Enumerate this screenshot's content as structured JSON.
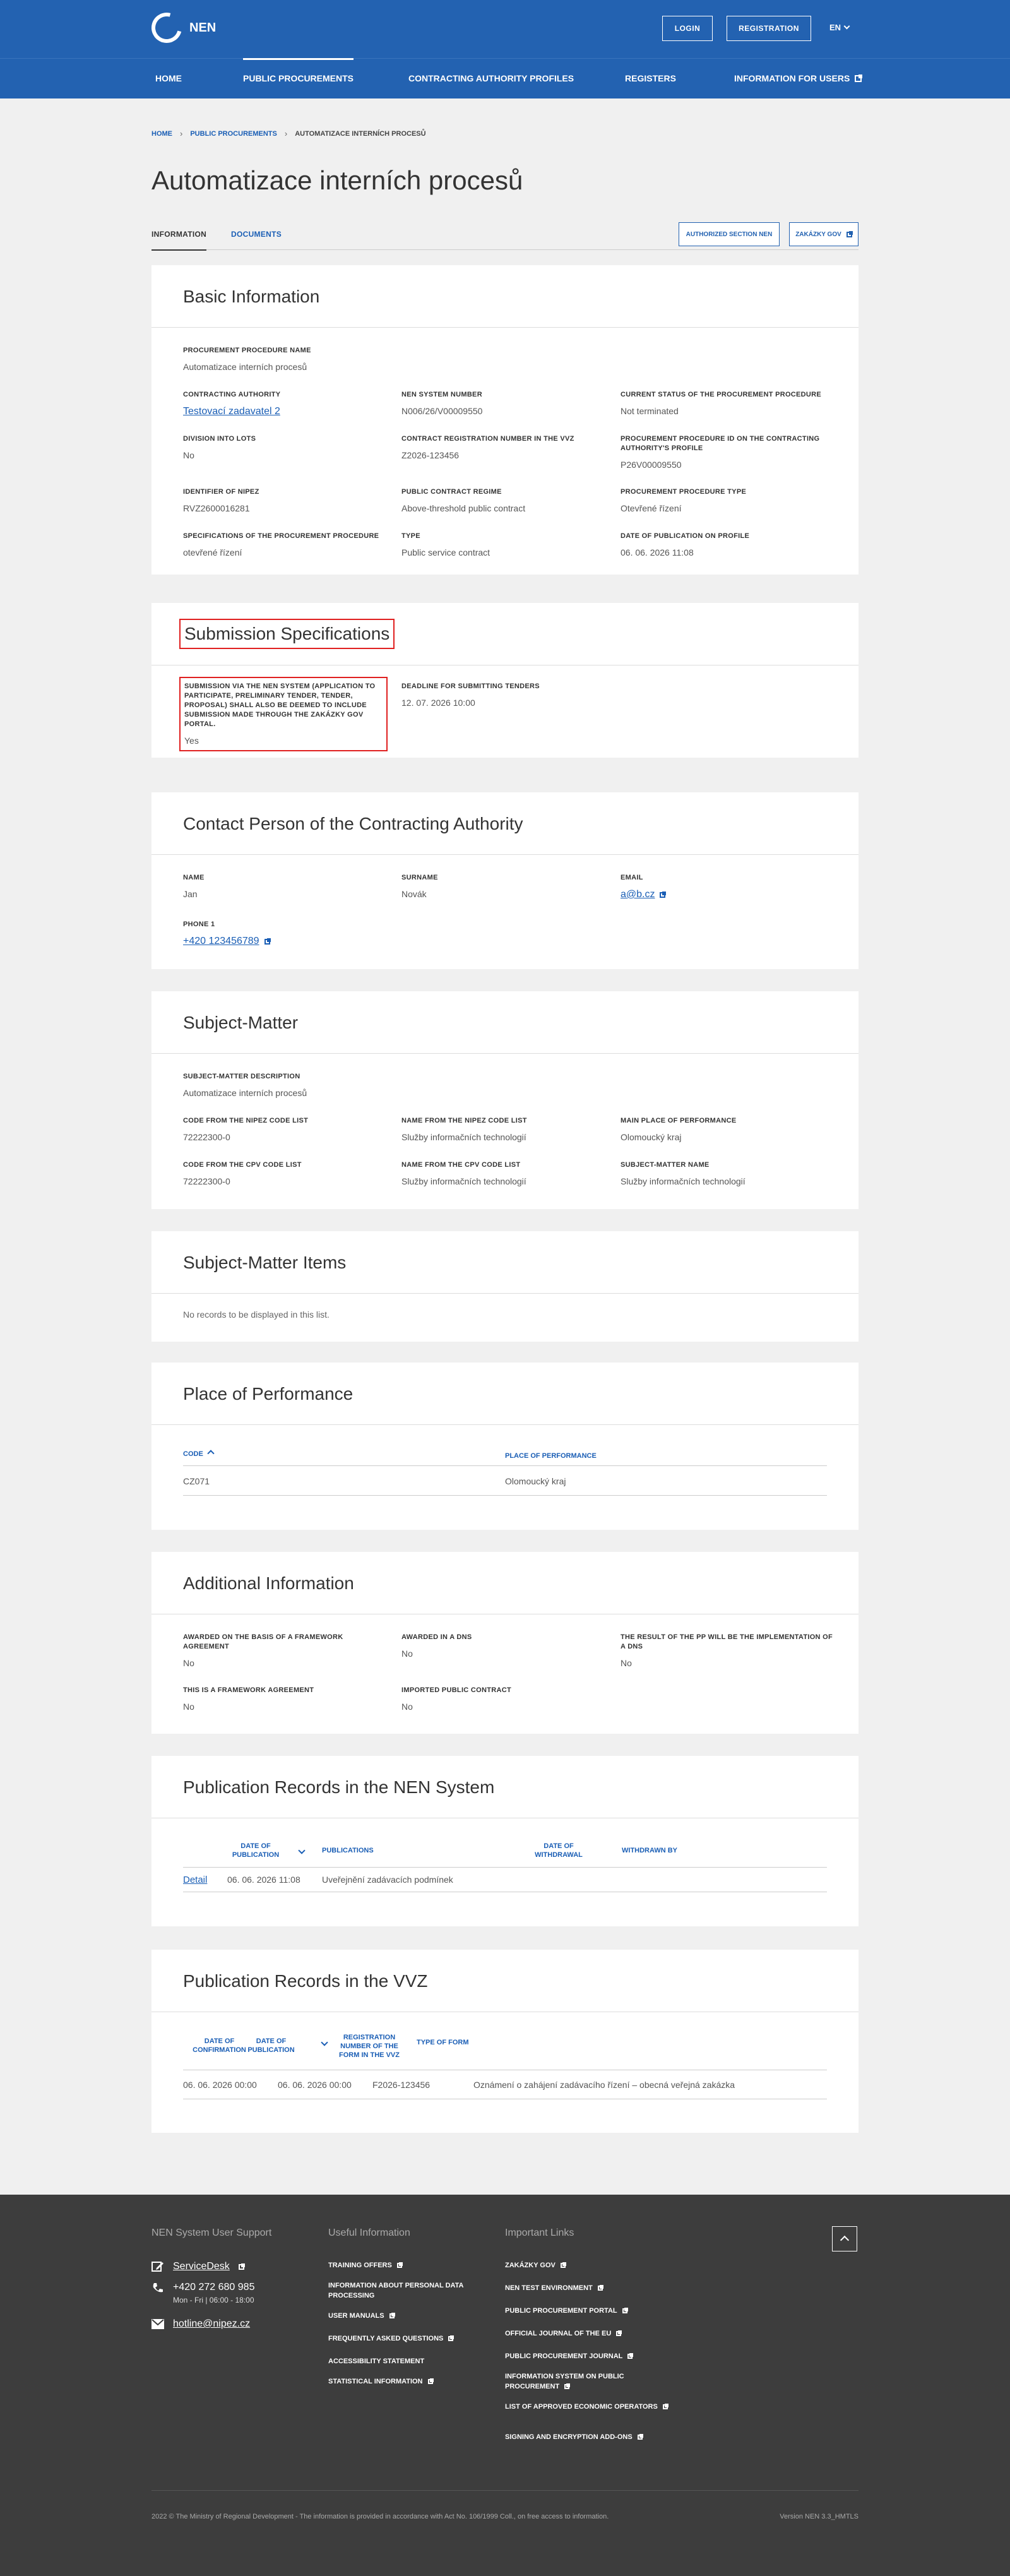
{
  "header": {
    "logo_text": "NEN",
    "login": "LOGIN",
    "registration": "REGISTRATION",
    "lang": "EN",
    "nav": [
      "HOME",
      "PUBLIC PROCUREMENTS",
      "CONTRACTING AUTHORITY PROFILES",
      "REGISTERS",
      "INFORMATION FOR USERS"
    ],
    "brand_color": "#2362b1"
  },
  "breadcrumb": [
    "HOME",
    "PUBLIC PROCUREMENTS",
    "AUTOMATIZACE INTERNÍCH PROCESŮ"
  ],
  "page_title": "Automatizace interních procesů",
  "tabs": [
    "INFORMATION",
    "DOCUMENTS"
  ],
  "tab_buttons": [
    "AUTHORIZED SECTION NEN",
    "ZAKÁZKY GOV"
  ],
  "basic": {
    "title": "Basic Information",
    "fields": [
      {
        "label": "PROCUREMENT PROCEDURE NAME",
        "value": "Automatizace interních procesů"
      },
      {
        "label": "CONTRACTING AUTHORITY",
        "value": "Testovací zadavatel 2"
      },
      {
        "label": "NEN SYSTEM NUMBER",
        "value": "N006/26/V00009550"
      },
      {
        "label": "CURRENT STATUS OF THE PROCUREMENT PROCEDURE",
        "value": "Not terminated"
      },
      {
        "label": "DIVISION INTO LOTS",
        "value": "No"
      },
      {
        "label": "CONTRACT REGISTRATION NUMBER IN THE VVZ",
        "value": "Z2026-123456"
      },
      {
        "label": "PROCUREMENT PROCEDURE ID ON THE CONTRACTING AUTHORITY'S PROFILE",
        "value": "P26V00009550"
      },
      {
        "label": "IDENTIFIER OF NIPEZ",
        "value": "RVZ2600016281"
      },
      {
        "label": "PUBLIC CONTRACT REGIME",
        "value": "Above-threshold public contract"
      },
      {
        "label": "PROCUREMENT PROCEDURE TYPE",
        "value": "Otevřené řízení"
      },
      {
        "label": "SPECIFICATIONS OF THE PROCUREMENT PROCEDURE",
        "value": "otevřené řízení"
      },
      {
        "label": "TYPE",
        "value": "Public service contract"
      },
      {
        "label": "DATE OF PUBLICATION ON PROFILE",
        "value": "06. 06. 2026 11:08"
      }
    ]
  },
  "submission": {
    "title": "Submission Specifications",
    "fields": [
      {
        "label": "SUBMISSION VIA THE NEN SYSTEM (APPLICATION TO PARTICIPATE, PRELIMINARY TENDER, TENDER, PROPOSAL) SHALL ALSO BE DEEMED TO INCLUDE SUBMISSION MADE THROUGH THE ZAKÁZKY GOV PORTAL.",
        "value": "Yes"
      },
      {
        "label": "DEADLINE FOR SUBMITTING TENDERS",
        "value": "12. 07. 2026 10:00"
      }
    ]
  },
  "contact": {
    "title": "Contact Person of the Contracting Authority",
    "fields": [
      {
        "label": "NAME",
        "value": "Jan"
      },
      {
        "label": "SURNAME",
        "value": "Novák"
      },
      {
        "label": "EMAIL",
        "value": "a@b.cz"
      },
      {
        "label": "PHONE 1",
        "value": "+420 123456789"
      }
    ]
  },
  "subject": {
    "title": "Subject-Matter",
    "fields": [
      {
        "label": "SUBJECT-MATTER DESCRIPTION",
        "value": "Automatizace interních procesů"
      },
      {
        "label": "CODE FROM THE NIPEZ CODE LIST",
        "value": "72222300-0"
      },
      {
        "label": "NAME FROM THE NIPEZ CODE LIST",
        "value": "Služby informačních technologií"
      },
      {
        "label": "MAIN PLACE OF PERFORMANCE",
        "value": "Olomoucký kraj"
      },
      {
        "label": "CODE FROM THE CPV CODE LIST",
        "value": "72222300-0"
      },
      {
        "label": "NAME FROM THE CPV CODE LIST",
        "value": "Služby informačních technologií"
      },
      {
        "label": "SUBJECT-MATTER NAME",
        "value": "Služby informačních technologií"
      }
    ]
  },
  "items": {
    "title": "Subject-Matter Items",
    "empty": "No records to be displayed in this list."
  },
  "place": {
    "title": "Place of Performance",
    "columns": [
      "CODE",
      "PLACE OF PERFORMANCE"
    ],
    "rows": [
      [
        "CZ071",
        "Olomoucký kraj"
      ]
    ]
  },
  "additional": {
    "title": "Additional Information",
    "fields": [
      {
        "label": "AWARDED ON THE BASIS OF A FRAMEWORK AGREEMENT",
        "value": "No"
      },
      {
        "label": "AWARDED IN A DNS",
        "value": "No"
      },
      {
        "label": "THE RESULT OF THE PP WILL BE THE IMPLEMENTATION OF A DNS",
        "value": "No"
      },
      {
        "label": "THIS IS A FRAMEWORK AGREEMENT",
        "value": "No"
      },
      {
        "label": "IMPORTED PUBLIC CONTRACT",
        "value": "No"
      }
    ]
  },
  "nen_records": {
    "title": "Publication Records in the NEN System",
    "columns": [
      "DATE OF PUBLICATION",
      "PUBLICATIONS",
      "DATE OF WITHDRAWAL",
      "WITHDRAWN BY"
    ],
    "row": {
      "detail": "Detail",
      "date": "06. 06. 2026 11:08",
      "publication": "Uveřejnění zadávacích podmínek"
    }
  },
  "vvz_records": {
    "title": "Publication Records in the VVZ",
    "columns": [
      "DATE OF CONFIRMATION",
      "DATE OF PUBLICATION",
      "REGISTRATION NUMBER OF THE FORM IN THE VVZ",
      "TYPE OF FORM"
    ],
    "row": [
      "06. 06. 2026 00:00",
      "06. 06. 2026 00:00",
      "F2026-123456",
      "Oznámení o zahájení zadávacího řízení – obecná veřejná zakázka"
    ]
  },
  "footer": {
    "support_title": "NEN System User Support",
    "servicedesk": "ServiceDesk",
    "phone": "+420 272 680 985",
    "hours": "Mon - Fri | 06:00 - 18:00",
    "email": "hotline@nipez.cz",
    "useful_title": "Useful Information",
    "useful": [
      "TRAINING OFFERS",
      "INFORMATION ABOUT PERSONAL DATA PROCESSING",
      "USER MANUALS",
      "FREQUENTLY ASKED QUESTIONS",
      "ACCESSIBILITY STATEMENT",
      "STATISTICAL INFORMATION"
    ],
    "links_title": "Important Links",
    "links": [
      "ZAKÁZKY GOV",
      "NEN TEST ENVIRONMENT",
      "PUBLIC PROCUREMENT PORTAL",
      "OFFICIAL JOURNAL OF THE EU",
      "PUBLIC PROCUREMENT JOURNAL",
      "INFORMATION SYSTEM ON PUBLIC PROCUREMENT",
      "LIST OF APPROVED ECONOMIC OPERATORS",
      "SIGNING AND ENCRYPTION ADD-ONS"
    ],
    "copyright": "2022 © The Ministry of Regional Development - The information is provided in accordance with Act No. 106/1999 Coll., on free access to information.",
    "version": "Version NEN 3.3_HMTLS"
  }
}
